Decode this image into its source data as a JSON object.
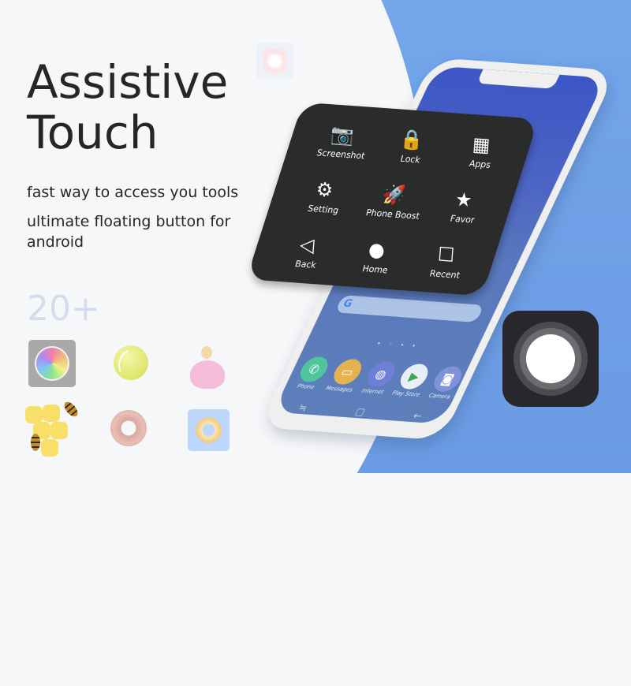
{
  "hero": {
    "title_line1": "Assistive",
    "title_line2": "Touch",
    "subtitle1": "fast way to access you tools",
    "subtitle2": "ultimate floating button for android"
  },
  "themes": {
    "count_label": "20+",
    "thumbnails": [
      "flower-of-life-theme",
      "tennis-ball-theme",
      "princess-theme",
      "honeycomb-bees-theme",
      "donut-theme",
      "orange-ring-theme"
    ]
  },
  "colors": {
    "accent_blue": "#6e9fe6",
    "panel_dark": "#2a2b2b",
    "text_dark": "#262626",
    "count_color": "#d4dbef"
  },
  "menu": {
    "items": [
      {
        "label": "Screenshot",
        "icon": "camera-plus-icon",
        "glyph": "📷"
      },
      {
        "label": "Lock",
        "icon": "lock-icon",
        "glyph": "🔒"
      },
      {
        "label": "Apps",
        "icon": "apps-grid-icon",
        "glyph": "▦"
      },
      {
        "label": "Setting",
        "icon": "gear-icon",
        "glyph": "⚙"
      },
      {
        "label": "Phone Boost",
        "icon": "rocket-icon",
        "glyph": "🚀"
      },
      {
        "label": "Favor",
        "icon": "star-icon",
        "glyph": "★"
      },
      {
        "label": "Back",
        "icon": "back-triangle-icon",
        "glyph": "◁"
      },
      {
        "label": "Home",
        "icon": "home-circle-icon",
        "glyph": "●"
      },
      {
        "label": "Recent",
        "icon": "recent-square-icon",
        "glyph": "☐"
      }
    ]
  },
  "phone": {
    "search_logo": "G",
    "dock": [
      {
        "label": "Phone",
        "glyph": "✆",
        "color": "#4fc59b"
      },
      {
        "label": "Messages",
        "glyph": "▭",
        "color": "#e5b24f"
      },
      {
        "label": "Internet",
        "glyph": "◍",
        "color": "#6d7fd6"
      },
      {
        "label": "Play Store",
        "glyph": "▶",
        "color": "#e9eef7"
      },
      {
        "label": "Camera",
        "glyph": "◙",
        "color": "#7f93db"
      }
    ],
    "nav": [
      "≒",
      "▢",
      "←"
    ],
    "page_dots": "• ◦ • •"
  }
}
